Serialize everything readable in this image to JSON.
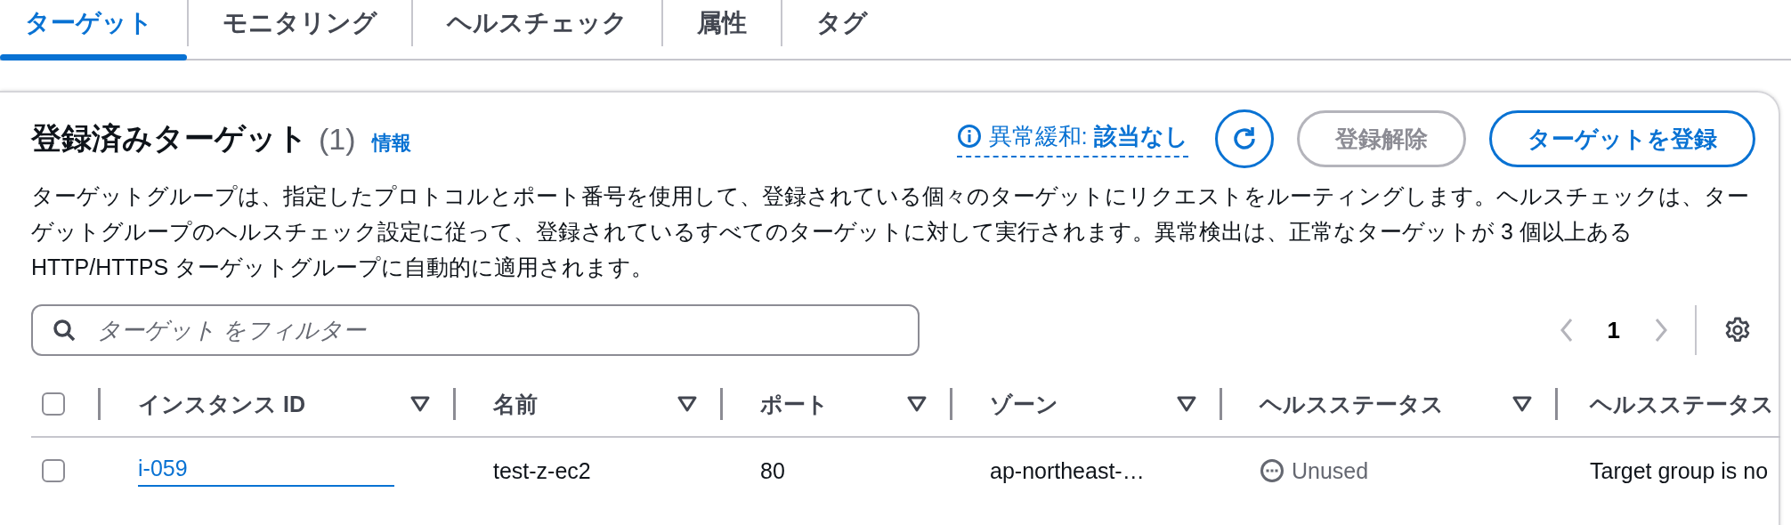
{
  "tabs": [
    {
      "label": "ターゲット",
      "selected": true
    },
    {
      "label": "モニタリング",
      "selected": false
    },
    {
      "label": "ヘルスチェック",
      "selected": false
    },
    {
      "label": "属性",
      "selected": false
    },
    {
      "label": "タグ",
      "selected": false
    }
  ],
  "panel": {
    "title": "登録済みターゲット",
    "count": "(1)",
    "info_link": "情報",
    "anomaly": {
      "label": "異常緩和:",
      "value": "該当なし"
    },
    "buttons": [
      {
        "label": "登録解除",
        "disabled": true
      },
      {
        "label": "ターゲットを登録",
        "disabled": false
      }
    ],
    "description": "ターゲットグループは、指定したプロトコルとポート番号を使用して、登録されている個々のターゲットにリクエストをルーティングします。ヘルスチェックは、ターゲットグループのヘルスチェック設定に従って、登録されているすべてのターゲットに対して実行されます。異常検出は、正常なターゲットが 3 個以上ある HTTP/HTTPS ターゲットグループに自動的に適用されます。",
    "filter": {
      "placeholder": "ターゲット をフィルター"
    },
    "pagination": {
      "page": "1",
      "prev_disabled": true,
      "next_disabled": true
    }
  },
  "table": {
    "all_selected": false,
    "columns": [
      {
        "label": "インスタンス ID",
        "sortable": true
      },
      {
        "label": "名前",
        "sortable": true
      },
      {
        "label": "ポート",
        "sortable": true
      },
      {
        "label": "ゾーン",
        "sortable": true
      },
      {
        "label": "ヘルスステータス",
        "sortable": true
      },
      {
        "label": "ヘルスステータス",
        "sortable": false
      }
    ],
    "rows": [
      {
        "selected": false,
        "cells": [
          {
            "kind": "link",
            "text": "i-059"
          },
          {
            "kind": "text",
            "text": "test-z-ec2"
          },
          {
            "kind": "text",
            "text": "80"
          },
          {
            "kind": "text",
            "text": "ap-northeast-…"
          },
          {
            "kind": "status",
            "text": "Unused"
          },
          {
            "kind": "text",
            "text": "Target group is no"
          }
        ]
      }
    ]
  }
}
